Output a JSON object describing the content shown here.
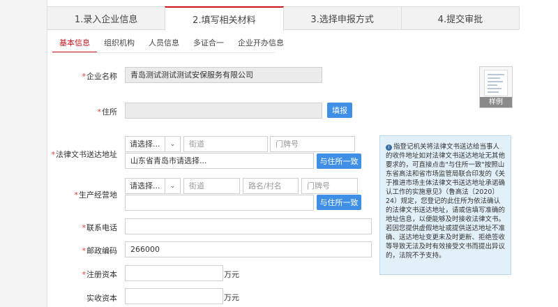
{
  "steps": [
    {
      "label": "1.录入企业信息"
    },
    {
      "label": "2.填写相关材料"
    },
    {
      "label": "3.选择申报方式"
    },
    {
      "label": "4.提交审批"
    }
  ],
  "subtabs": [
    {
      "label": "基本信息"
    },
    {
      "label": "组织机构"
    },
    {
      "label": "人员信息"
    },
    {
      "label": "多证合一"
    },
    {
      "label": "企业开办信息"
    }
  ],
  "form": {
    "company_name": {
      "label": "企业名称",
      "value": "青岛测试测试测试安保服务有限公司"
    },
    "address": {
      "label": "住所",
      "value": "",
      "button": "填报"
    },
    "legal_address": {
      "label": "法律文书送达地址",
      "select": "请选择...",
      "street_placeholder": "街道",
      "door_placeholder": "门牌号",
      "region": "山东省青岛市请选择...",
      "same_button": "与住所一致"
    },
    "business_address": {
      "label": "生产经营地",
      "select": "请选择...",
      "street_placeholder": "街道",
      "road_placeholder": "路名/村名",
      "door_placeholder": "门牌号",
      "same_button": "与住所一致"
    },
    "phone": {
      "label": "联系电话",
      "value": ""
    },
    "postcode": {
      "label": "邮政编码",
      "value": "266000"
    },
    "registered_capital": {
      "label": "注册资本",
      "value": "",
      "unit": "万元"
    },
    "paid_capital": {
      "label": "实收资本",
      "value": "",
      "unit": "万元"
    }
  },
  "sample": {
    "caption": "样例"
  },
  "notice": {
    "text": "指登记机关将法律文书送达给当事人的收件地址如对法律文书送达地址无其他要求的，可直接点击\"与住所一致\"按照山东省高法和省市场监管局联合印发的《关于推进市场主体法律文书送达地址承诺确认工作的实施意见》（鲁高法〔2020〕24）规定，您登记的此住所为依法确认的法律文书送达地址，请或信填写准确的地址信息，以便能够及时接收法律文书。若因您提供虚假地址或提供送达地址不准确、送达地址变更未及时更新、拒绝签收等导致无法及时有效接受文书而提出异议的，法院不予支持。"
  },
  "colors": {
    "accent": "#c8161d",
    "button": "#3f8fe6",
    "notice_bg": "#e2f0fa",
    "required": "#e23b3b"
  },
  "icons": {
    "notice": "info-icon",
    "select": "chevron-down-icon"
  }
}
